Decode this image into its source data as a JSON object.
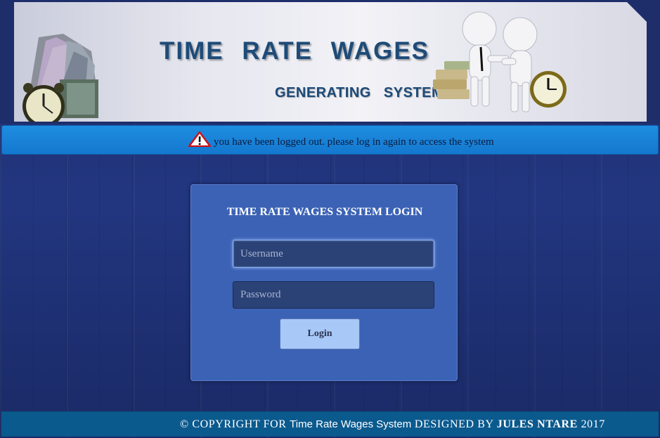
{
  "header": {
    "title": "TIME   RATE   WAGES",
    "subtitle": "GENERATING   SYSTEM"
  },
  "alert": {
    "icon": "warning-icon",
    "message": "you have been logged out. please log in again to access the system",
    "color": "#1e8de0"
  },
  "login": {
    "title": "TIME RATE WAGES SYSTEM LOGIN",
    "username_placeholder": "Username",
    "username_value": "",
    "password_placeholder": "Password",
    "password_value": "",
    "button_label": "Login",
    "card_color": "#3b62b5",
    "button_color": "#a8c8f7"
  },
  "footer": {
    "prefix": "© COPYRIGHT FOR",
    "system_name": "Time Rate Wages System",
    "designed_by": "DESIGNED BY",
    "author": "JULES NTARE",
    "year": "2017",
    "color": "#0b5a8e"
  }
}
